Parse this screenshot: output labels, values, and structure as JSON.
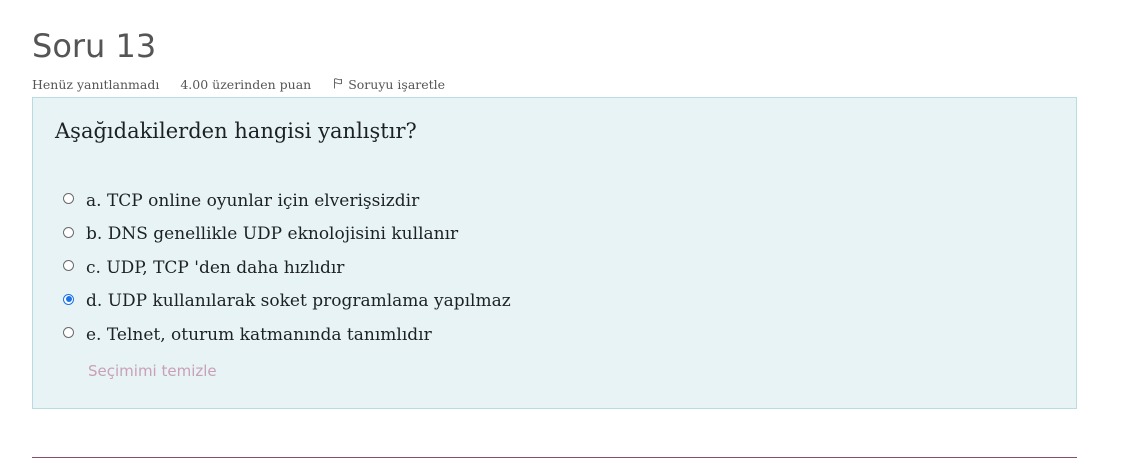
{
  "question": {
    "title": "Soru 13",
    "status": "Henüz yanıtlanmadı",
    "grade": "4.00 üzerinden puan",
    "flag_label": "Soruyu işaretle",
    "text": "Aşağıdakilerden hangisi yanlıştır?",
    "options": [
      {
        "label": "a. TCP online oyunlar için elverişsizdir",
        "selected": false
      },
      {
        "label": "b. DNS genellikle UDP eknolojisini kullanır",
        "selected": false
      },
      {
        "label": "c. UDP, TCP 'den daha hızlıdır",
        "selected": false
      },
      {
        "label": "d. UDP kullanılarak soket programlama yapılmaz",
        "selected": true
      },
      {
        "label": "e. Telnet, oturum katmanında tanımlıdır",
        "selected": false
      }
    ],
    "clear_choice_label": "Seçimimi temizle"
  },
  "colors": {
    "panel_background": "#e7f3f5",
    "panel_border": "#b8dce2",
    "selected_radio": "#1a73e8",
    "clear_link": "#c9a0b7",
    "divider": "#8c4a6e"
  },
  "icons": {
    "flag": "flag-icon"
  }
}
